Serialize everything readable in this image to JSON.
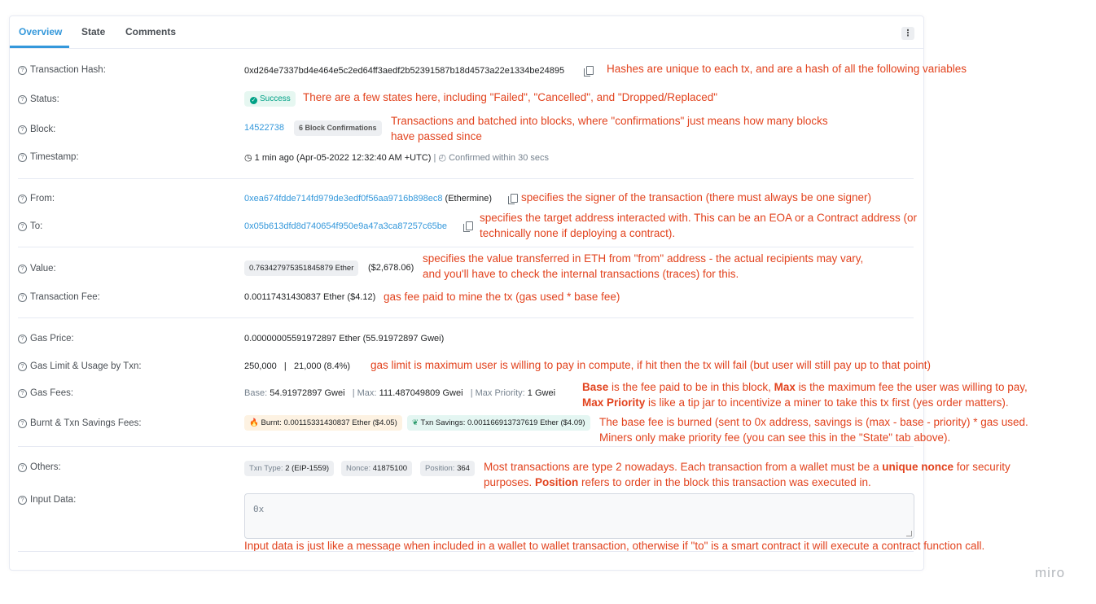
{
  "tabs": [
    "Overview",
    "State",
    "Comments"
  ],
  "menu_icon": "kebab-vertical-icon",
  "rows": {
    "tx_hash": {
      "label": "Transaction Hash:",
      "value": "0xd264e7337bd4e464e5c2ed64ff3aedf2b52391587b18d4573a22e1334be24895"
    },
    "status": {
      "label": "Status:",
      "value": "Success"
    },
    "block": {
      "label": "Block:",
      "number": "14522738",
      "confirmations": "6 Block Confirmations"
    },
    "timestamp": {
      "label": "Timestamp:",
      "value": "1 min ago (Apr-05-2022 12:32:40 AM +UTC)",
      "sep": "|",
      "confirmed": "Confirmed within 30 secs"
    },
    "from": {
      "label": "From:",
      "address": "0xea674fdde714fd979de3edf0f56aa9716b898ec8",
      "name": "(Ethermine)"
    },
    "to": {
      "label": "To:",
      "address": "0x05b613dfd8d740654f950e9a47a3ca87257c65be"
    },
    "value": {
      "label": "Value:",
      "ether": "0.763427975351845879 Ether",
      "usd": "($2,678.06)"
    },
    "tx_fee": {
      "label": "Transaction Fee:",
      "value": "0.00117431430837 Ether ($4.12)"
    },
    "gas_price": {
      "label": "Gas Price:",
      "value": "0.00000005591972897 Ether (55.91972897 Gwei)"
    },
    "gas_limit": {
      "label": "Gas Limit & Usage by Txn:",
      "value": "250,000   |   21,000 (8.4%)"
    },
    "gas_fees": {
      "label": "Gas Fees:",
      "base_label": "Base:",
      "base": "54.91972897 Gwei",
      "max_label": "|  Max:",
      "max": "111.487049809 Gwei",
      "prio_label": "|  Max Priority:",
      "prio": "1 Gwei"
    },
    "burnt": {
      "label": "Burnt & Txn Savings Fees:",
      "burnt": "Burnt: 0.00115331430837 Ether ($4.05)",
      "savings": "Txn Savings: 0.001166913737619 Ether ($4.09)"
    },
    "others": {
      "label": "Others:",
      "tx_type_label": "Txn Type:",
      "tx_type": "2 (EIP-1559)",
      "nonce_label": "Nonce:",
      "nonce": "41875100",
      "position_label": "Position:",
      "position": "364"
    },
    "input": {
      "label": "Input Data:",
      "value": "0x"
    }
  },
  "annotations": {
    "hash": "Hashes are unique to each tx, and are a hash of all the following variables",
    "status": "There are a few states here, including \"Failed\", \"Cancelled\", and \"Dropped/Replaced\"",
    "block_1": "Transactions and batched into blocks, where \"confirmations\" just means how many blocks",
    "block_2": "have passed since",
    "from": "specifies the signer of the transaction (there must always be one signer)",
    "to_1": "specifies the target address interacted with. This can be an EOA or a Contract address (or",
    "to_2": "technically none if deploying a contract).",
    "value_1": "specifies the value transferred in ETH from \"from\" address - the actual recipients may vary,",
    "value_2": "and you'll have to check the internal transactions (traces) for this.",
    "fee": "gas fee paid to mine the tx (gas used * base fee)",
    "gas_limit": "gas limit is maximum user is willing to pay in compute, if hit then the tx will fail (but user will still pay up to that point)",
    "gas_fees_1a": "Base",
    "gas_fees_1b": " is the fee paid to be in this block, ",
    "gas_fees_1c": "Max",
    "gas_fees_1d": " is the maximum fee the user was willing to pay,",
    "gas_fees_2a": "Max Priority",
    "gas_fees_2b": " is like a tip jar to incentivize a miner to take this tx first (yes order matters).",
    "burnt_1": "The base fee is burned (sent to 0x address, savings is (max - base - priority) * gas used.",
    "burnt_2": "Miners only make priority fee (you can see this in the \"State\" tab above).",
    "others_1a": "Most transactions are type 2 nowadays. Each transaction from a wallet must be a ",
    "others_1b": "unique nonce",
    "others_1c": " for security",
    "others_2a": "purposes. ",
    "others_2b": "Position",
    "others_2c": " refers to order in the block this transaction was executed in.",
    "input": "Input data is just like a message when included in a wallet to wallet transaction, otherwise if \"to\" is a smart contract it will execute a contract function call."
  },
  "watermark": "miro",
  "colors": {
    "accent": "#3498db",
    "annotation": "#e2431e",
    "success": "#00a186"
  }
}
